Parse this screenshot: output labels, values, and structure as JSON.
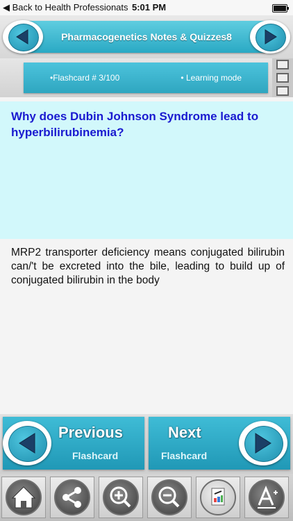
{
  "status_bar": {
    "back_label": "◀ Back to Health Professionats",
    "time": "5:01 PM"
  },
  "header": {
    "title": "Pharmacogenetics Notes & Quizzes8"
  },
  "info_bar": {
    "flashcard_label": "•Flashcard #  3/100",
    "mode_label": "• Learning mode"
  },
  "card": {
    "question": "Why does Dubin Johnson Syndrome lead to hyperbilirubinemia?",
    "answer": "MRP2 transporter deficiency means conjugated bilirubin can/'t be excreted into the bile, leading to build up of conjugated bilirubin in the body"
  },
  "navigation": {
    "previous": {
      "line1": "Previous",
      "line2": "Flashcard"
    },
    "next": {
      "line1": "Next",
      "line2": "Flashcard"
    }
  },
  "toolbar": {
    "icons": [
      "home-icon",
      "share-icon",
      "zoom-in-icon",
      "zoom-out-icon",
      "color-palette-icon",
      "font-icon"
    ]
  },
  "colors": {
    "accent": "#2fa6c0",
    "question_bg": "#d2f8fb",
    "question_text": "#1a1ad0"
  }
}
